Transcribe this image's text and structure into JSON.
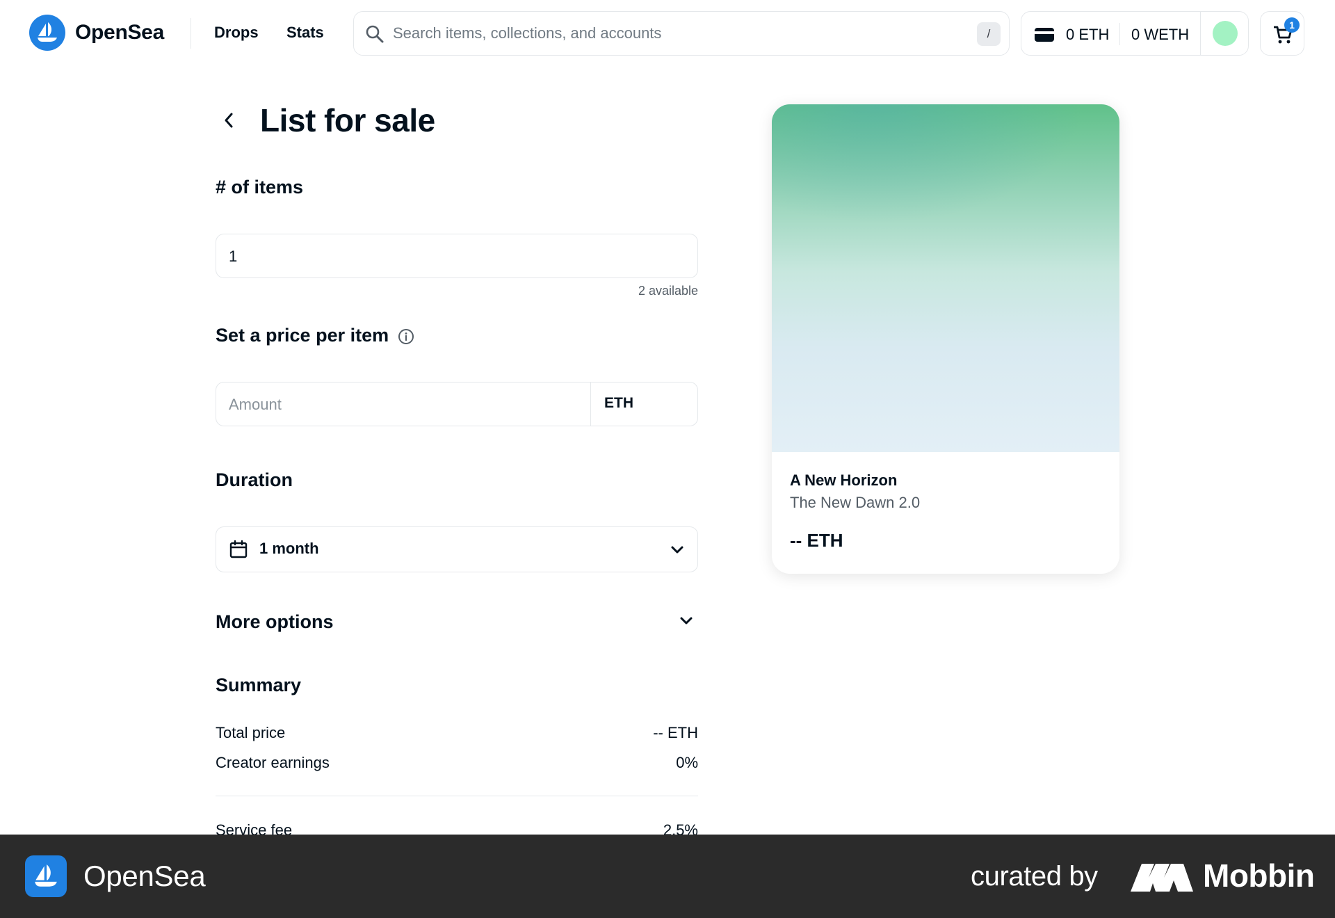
{
  "header": {
    "brand": "OpenSea",
    "nav": {
      "drops": "Drops",
      "stats": "Stats"
    },
    "search": {
      "placeholder": "Search items, collections, and accounts",
      "shortcut": "/"
    },
    "wallet": {
      "eth": "0 ETH",
      "weth": "0 WETH"
    },
    "cart_count": "1",
    "colors": {
      "brand": "#2081e2",
      "avatar": "#a3f2c3"
    }
  },
  "form": {
    "title": "List for sale",
    "items": {
      "heading": "# of items",
      "value": "1",
      "available": "2 available"
    },
    "price": {
      "heading": "Set a price per item",
      "placeholder": "Amount",
      "currency": "ETH"
    },
    "duration": {
      "heading": "Duration",
      "value": "1 month"
    },
    "more_options": "More options",
    "summary": {
      "heading": "Summary",
      "rows": [
        {
          "label": "Total price",
          "value": "-- ETH"
        },
        {
          "label": "Creator earnings",
          "value": "0%"
        },
        {
          "label": "Service fee",
          "value": "2.5%"
        }
      ]
    }
  },
  "preview": {
    "collection": "A New Horizon",
    "name": "The New Dawn 2.0",
    "price": "-- ETH"
  },
  "footer": {
    "brand": "OpenSea",
    "curated_by": "curated by",
    "curator": "Mobbin"
  },
  "icons": [
    "opensea-logo-icon",
    "search-icon",
    "wallet-icon",
    "cart-icon",
    "back-chevron-icon",
    "info-icon",
    "calendar-icon",
    "chevron-down-icon",
    "mobbin-logo-icon"
  ]
}
